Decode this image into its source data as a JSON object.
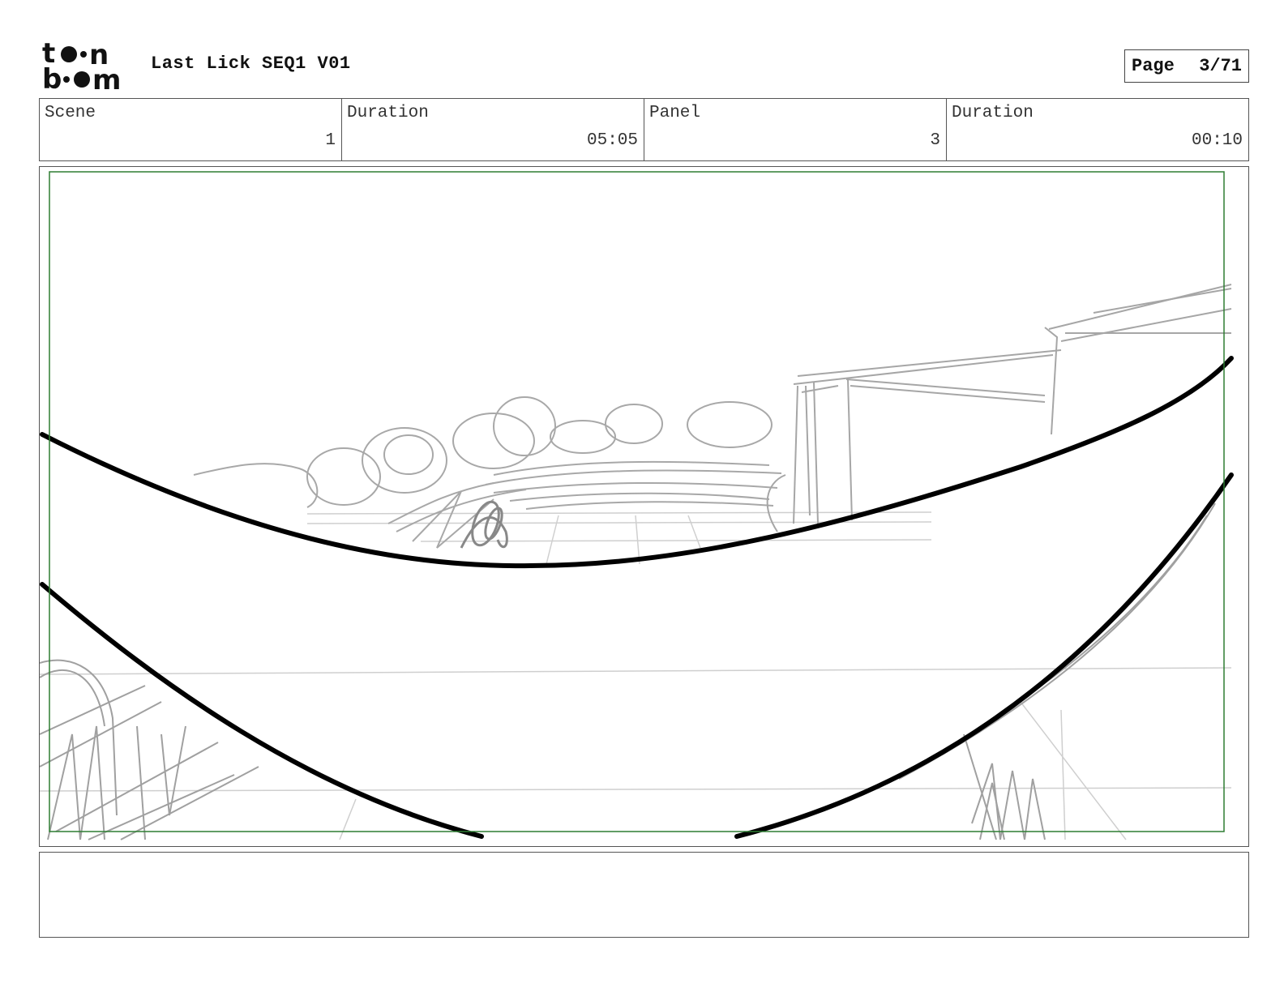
{
  "header": {
    "logo_label": "toon boom",
    "title": "Last Lick SEQ1 V01",
    "page_label": "Page",
    "page_number": "3/71"
  },
  "info": {
    "scene_label": "Scene",
    "scene_value": "1",
    "scene_duration_label": "Duration",
    "scene_duration_value": "05:05",
    "panel_label": "Panel",
    "panel_value": "3",
    "panel_duration_label": "Duration",
    "panel_duration_value": "00:10"
  },
  "colors": {
    "frame_guide": "#2e7d32",
    "sketch_grey": "#9e9e9e",
    "ink": "#000000"
  },
  "notes": {
    "text": ""
  }
}
